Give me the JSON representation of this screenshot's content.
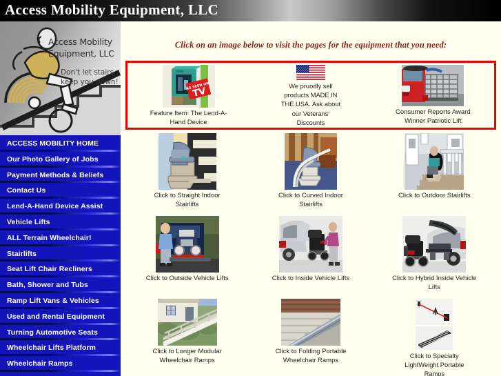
{
  "header": {
    "site_title": "Access Mobility Equipment, LLC"
  },
  "logo": {
    "alt_name": "access-mobility-logo",
    "company_line1": "Access Mobility",
    "company_line2": "Equipment, LLC",
    "tagline": "Don't let stairs keep you down!"
  },
  "sidebar": {
    "items": [
      {
        "label": "ACCESS MOBILITY HOME"
      },
      {
        "label": "Our Photo Gallery of Jobs"
      },
      {
        "label": "Payment Methods & Beliefs"
      },
      {
        "label": "Contact Us"
      },
      {
        "label": "Lend-A-Hand Device Assist"
      },
      {
        "label": "Vehicle Lifts"
      },
      {
        "label": "ALL Terrain Wheelchair!"
      },
      {
        "label": "Stairlifts"
      },
      {
        "label": "Seat Lift Chair Recliners"
      },
      {
        "label": "Bath, Shower and Tubs"
      },
      {
        "label": "Ramp Lift Vans & Vehicles"
      },
      {
        "label": "Used and Rental Equipment"
      },
      {
        "label": "Turning Automotive Seats"
      },
      {
        "label": "Wheelchair Lifts Platform"
      },
      {
        "label": "Wheelchair Ramps"
      }
    ]
  },
  "main": {
    "intro": "Click on an image below to visit the pages for the equipment that you need:",
    "feature_row": {
      "border_color": "#ee0000",
      "cells": [
        {
          "caption": "Feature Item: The Lend-A-Hand Device",
          "image": "lend-a-hand-box-as-seen-on-tv"
        },
        {
          "caption": "We pruodly sell products MADE IN THE USA. Ask about our Veterans' Discounts",
          "image": "american-flag"
        },
        {
          "caption": "Consumer Reports Award Winner Patriotic Lift",
          "image": "red-suv-with-vehicle-lift"
        }
      ]
    },
    "grid_rows": [
      [
        {
          "caption": "Click to Straight Indoor Stairlifts",
          "image": "straight-indoor-stairlift"
        },
        {
          "caption": "Click to Curved Indoor Stairlifts",
          "image": "curved-indoor-stairlift"
        },
        {
          "caption": "Click to Outdoor Stairlifts",
          "image": "outdoor-stairlift"
        }
      ],
      [
        {
          "caption": "Click to Outside Vehicle Lifts",
          "image": "outside-vehicle-lift"
        },
        {
          "caption": "Click to Inside Vehicle Lifts",
          "image": "inside-vehicle-lift"
        },
        {
          "caption": "Click to Hybrid Inside Vehicle Lifts",
          "image": "hybrid-inside-vehicle-lift"
        }
      ],
      [
        {
          "caption": "Click to Longer Modular Wheelchair Ramps",
          "image": "modular-wheelchair-ramp"
        },
        {
          "caption": "Click to Folding Portable Wheelchair Ramps",
          "image": "folding-portable-ramp"
        },
        {
          "caption": "Click to Specialty LightWeight Portable Ramps",
          "image": "specialty-lightweight-ramp"
        }
      ]
    ]
  },
  "colors": {
    "sidebar_bg": "#1414bb",
    "page_bg": "#fffff0",
    "accent_red": "#ee0000",
    "intro_text": "#8c1c13"
  }
}
